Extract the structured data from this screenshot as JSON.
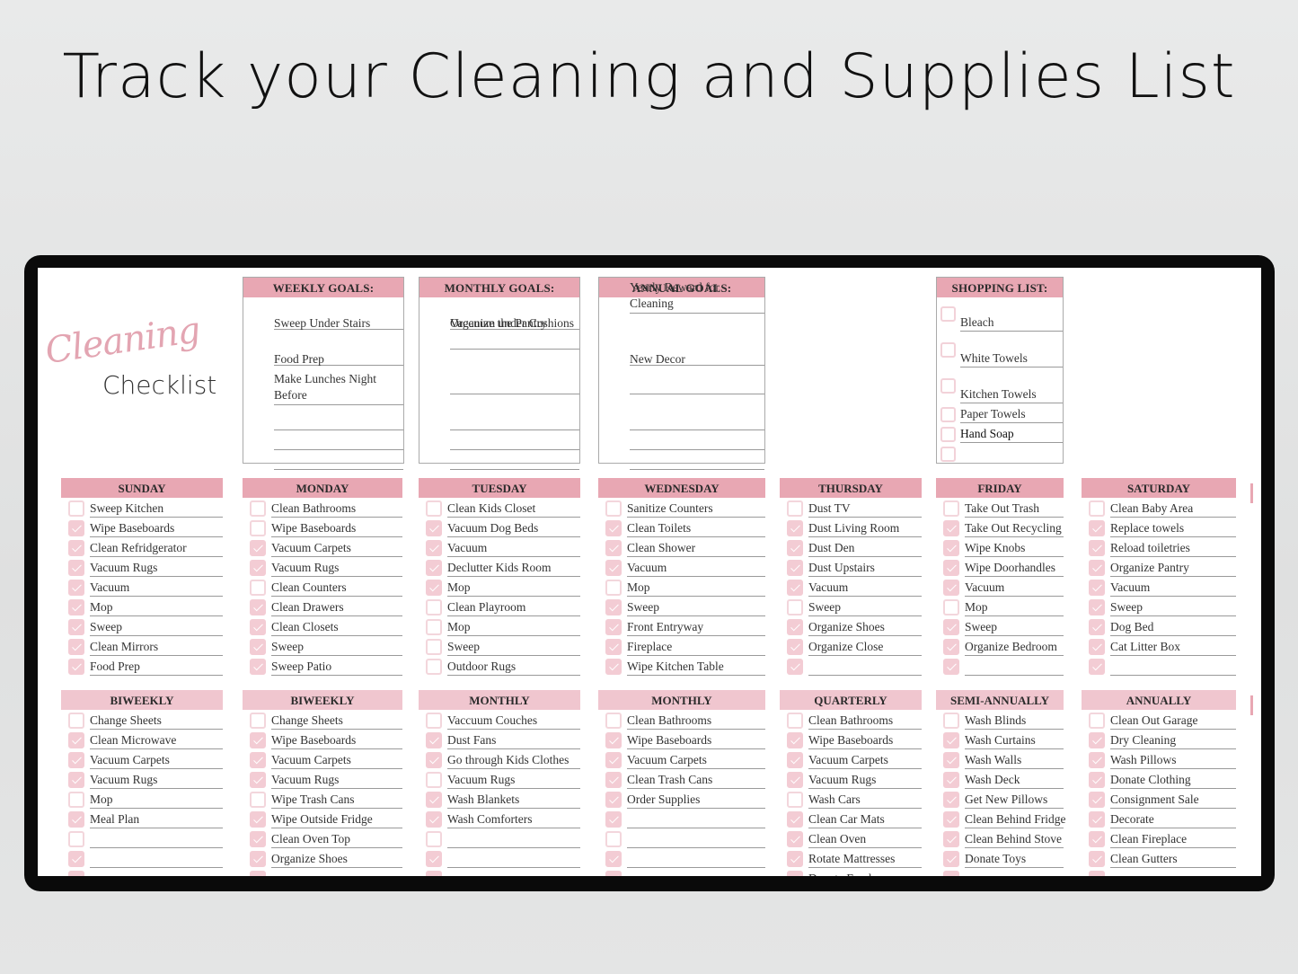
{
  "headline": "Track your Cleaning and Supplies List",
  "logo": {
    "script": "Cleaning",
    "word": "Checklist"
  },
  "colors": {
    "header_pink": "#e8a7b3",
    "header_light_pink": "#f0c6cf",
    "checkbox_pink": "#f3ccd4",
    "frame": "#0a0a0a"
  },
  "goals": [
    {
      "title": "WEEKLY GOALS:",
      "items": [
        "Sweep Under Stairs",
        "Food Prep",
        "Make Lunches Night Before",
        "",
        "",
        ""
      ]
    },
    {
      "title": "MONTHLY GOALS:",
      "items": [
        "Organize the Pantry",
        "Vaccuum under Cushions",
        "",
        "",
        "",
        ""
      ]
    },
    {
      "title": "ANNUAL GOALS:",
      "items": [
        "Yearly Reward for Cleaning",
        "New Decor",
        "",
        "",
        "",
        ""
      ]
    }
  ],
  "shopping": {
    "title": "SHOPPING LIST:",
    "items": [
      {
        "label": "Bleach",
        "checked": false
      },
      {
        "label": "White Towels",
        "checked": false
      },
      {
        "label": "Kitchen Towels",
        "checked": false
      },
      {
        "label": "Paper Towels",
        "checked": false
      },
      {
        "label": "Hand Soap",
        "checked": false
      },
      {
        "label": "",
        "checked": false
      }
    ]
  },
  "days": [
    {
      "title": "SUNDAY",
      "items": [
        {
          "label": "Sweep Kitchen",
          "checked": false
        },
        {
          "label": "Wipe Baseboards",
          "checked": true
        },
        {
          "label": "Clean Refridgerator",
          "checked": true
        },
        {
          "label": "Vacuum Rugs",
          "checked": true
        },
        {
          "label": "Vacuum",
          "checked": true
        },
        {
          "label": "Mop",
          "checked": true
        },
        {
          "label": "Sweep",
          "checked": true
        },
        {
          "label": "Clean Mirrors",
          "checked": true
        },
        {
          "label": "Food Prep",
          "checked": true
        }
      ]
    },
    {
      "title": "MONDAY",
      "items": [
        {
          "label": "Clean Bathrooms",
          "checked": false
        },
        {
          "label": "Wipe Baseboards",
          "checked": false
        },
        {
          "label": "Vacuum Carpets",
          "checked": true
        },
        {
          "label": "Vacuum Rugs",
          "checked": true
        },
        {
          "label": "Clean Counters",
          "checked": false
        },
        {
          "label": "Clean Drawers",
          "checked": true
        },
        {
          "label": "Clean Closets",
          "checked": true
        },
        {
          "label": "Sweep",
          "checked": true
        },
        {
          "label": "Sweep Patio",
          "checked": true
        }
      ]
    },
    {
      "title": "TUESDAY",
      "items": [
        {
          "label": "Clean Kids Closet",
          "checked": false
        },
        {
          "label": "Vacuum Dog Beds",
          "checked": true
        },
        {
          "label": "Vacuum",
          "checked": true
        },
        {
          "label": "Declutter Kids Room",
          "checked": true
        },
        {
          "label": "Mop",
          "checked": true
        },
        {
          "label": "Clean Playroom",
          "checked": false
        },
        {
          "label": "Mop",
          "checked": false
        },
        {
          "label": "Sweep",
          "checked": false
        },
        {
          "label": "Outdoor Rugs",
          "checked": false
        }
      ]
    },
    {
      "title": "WEDNESDAY",
      "items": [
        {
          "label": "Sanitize Counters",
          "checked": false
        },
        {
          "label": "Clean Toilets",
          "checked": true
        },
        {
          "label": "Clean Shower",
          "checked": true
        },
        {
          "label": "Vacuum",
          "checked": true
        },
        {
          "label": "Mop",
          "checked": false
        },
        {
          "label": "Sweep",
          "checked": true
        },
        {
          "label": "Front Entryway",
          "checked": true
        },
        {
          "label": "Fireplace",
          "checked": true
        },
        {
          "label": "Wipe Kitchen Table",
          "checked": true
        }
      ]
    },
    {
      "title": "THURSDAY",
      "items": [
        {
          "label": "Dust TV",
          "checked": false
        },
        {
          "label": "Dust Living Room",
          "checked": true
        },
        {
          "label": "Dust Den",
          "checked": true
        },
        {
          "label": "Dust Upstairs",
          "checked": true
        },
        {
          "label": "Vacuum",
          "checked": true
        },
        {
          "label": "Sweep",
          "checked": false
        },
        {
          "label": "Organize Shoes",
          "checked": true
        },
        {
          "label": "Organize Close",
          "checked": true
        },
        {
          "label": "",
          "checked": true
        }
      ]
    },
    {
      "title": "FRIDAY",
      "items": [
        {
          "label": "Take Out Trash",
          "checked": false
        },
        {
          "label": "Take Out Recycling",
          "checked": true
        },
        {
          "label": "Wipe Knobs",
          "checked": true
        },
        {
          "label": "Wipe Doorhandles",
          "checked": true
        },
        {
          "label": "Vacuum",
          "checked": true
        },
        {
          "label": "Mop",
          "checked": false
        },
        {
          "label": "Sweep",
          "checked": true
        },
        {
          "label": "Organize Bedroom",
          "checked": true
        },
        {
          "label": "",
          "checked": true
        }
      ]
    },
    {
      "title": "SATURDAY",
      "items": [
        {
          "label": "Clean Baby Area",
          "checked": false
        },
        {
          "label": "Replace towels",
          "checked": true
        },
        {
          "label": "Reload toiletries",
          "checked": true
        },
        {
          "label": "Organize Pantry",
          "checked": true
        },
        {
          "label": "Vacuum",
          "checked": true
        },
        {
          "label": "Sweep",
          "checked": true
        },
        {
          "label": "Dog Bed",
          "checked": true
        },
        {
          "label": "Cat Litter Box",
          "checked": true
        },
        {
          "label": "",
          "checked": true
        }
      ]
    }
  ],
  "periodic": [
    {
      "title": "BIWEEKLY",
      "items": [
        {
          "label": "Change Sheets",
          "checked": false
        },
        {
          "label": "Clean Microwave",
          "checked": true
        },
        {
          "label": "Vacuum Carpets",
          "checked": true
        },
        {
          "label": "Vacuum Rugs",
          "checked": true
        },
        {
          "label": "Mop",
          "checked": false
        },
        {
          "label": "Meal Plan",
          "checked": true
        },
        {
          "label": "",
          "checked": false
        },
        {
          "label": "",
          "checked": true
        },
        {
          "label": "",
          "checked": true
        }
      ]
    },
    {
      "title": "BIWEEKLY",
      "items": [
        {
          "label": "Change Sheets",
          "checked": false
        },
        {
          "label": "Wipe Baseboards",
          "checked": true
        },
        {
          "label": "Vacuum Carpets",
          "checked": true
        },
        {
          "label": "Vacuum Rugs",
          "checked": true
        },
        {
          "label": "Wipe Trash Cans",
          "checked": false
        },
        {
          "label": "Wipe Outside Fridge",
          "checked": true
        },
        {
          "label": "Clean Oven Top",
          "checked": true
        },
        {
          "label": "Organize Shoes",
          "checked": true
        },
        {
          "label": "",
          "checked": true
        }
      ]
    },
    {
      "title": "MONTHLY",
      "items": [
        {
          "label": "Vaccuum Couches",
          "checked": false
        },
        {
          "label": "Dust Fans",
          "checked": true
        },
        {
          "label": "Go through Kids Clothes",
          "checked": true
        },
        {
          "label": "Vacuum Rugs",
          "checked": false
        },
        {
          "label": "Wash Blankets",
          "checked": true
        },
        {
          "label": "Wash Comforters",
          "checked": true
        },
        {
          "label": "",
          "checked": false
        },
        {
          "label": "",
          "checked": true
        },
        {
          "label": "",
          "checked": true
        }
      ]
    },
    {
      "title": "MONTHLY",
      "items": [
        {
          "label": "Clean Bathrooms",
          "checked": false
        },
        {
          "label": "Wipe Baseboards",
          "checked": true
        },
        {
          "label": "Vacuum Carpets",
          "checked": true
        },
        {
          "label": "Clean Trash Cans",
          "checked": true
        },
        {
          "label": "Order Supplies",
          "checked": true
        },
        {
          "label": "",
          "checked": true
        },
        {
          "label": "",
          "checked": false
        },
        {
          "label": "",
          "checked": true
        },
        {
          "label": "",
          "checked": true
        }
      ]
    },
    {
      "title": "QUARTERLY",
      "items": [
        {
          "label": "Clean Bathrooms",
          "checked": false
        },
        {
          "label": "Wipe Baseboards",
          "checked": true
        },
        {
          "label": "Vacuum Carpets",
          "checked": true
        },
        {
          "label": "Vacuum Rugs",
          "checked": true
        },
        {
          "label": "Wash Cars",
          "checked": false
        },
        {
          "label": "Clean Car Mats",
          "checked": true
        },
        {
          "label": "Clean Oven",
          "checked": true
        },
        {
          "label": "Rotate Mattresses",
          "checked": true
        },
        {
          "label": "Donate Food",
          "checked": true
        }
      ]
    },
    {
      "title": "SEMI-ANNUALLY",
      "items": [
        {
          "label": "Wash Blinds",
          "checked": false
        },
        {
          "label": "Wash Curtains",
          "checked": true
        },
        {
          "label": "Wash Walls",
          "checked": true
        },
        {
          "label": "Wash Deck",
          "checked": true
        },
        {
          "label": "Get New Pillows",
          "checked": true
        },
        {
          "label": "Clean Behind Fridge",
          "checked": true
        },
        {
          "label": "Clean Behind Stove",
          "checked": true
        },
        {
          "label": "Donate Toys",
          "checked": true
        },
        {
          "label": "",
          "checked": true
        }
      ]
    },
    {
      "title": "ANNUALLY",
      "items": [
        {
          "label": "Clean Out Garage",
          "checked": false
        },
        {
          "label": "Dry Cleaning",
          "checked": true
        },
        {
          "label": "Wash Pillows",
          "checked": true
        },
        {
          "label": "Donate Clothing",
          "checked": true
        },
        {
          "label": "Consignment Sale",
          "checked": true
        },
        {
          "label": "Decorate",
          "checked": true
        },
        {
          "label": "Clean Fireplace",
          "checked": true
        },
        {
          "label": "Clean Gutters",
          "checked": true
        },
        {
          "label": "",
          "checked": true
        }
      ]
    }
  ]
}
